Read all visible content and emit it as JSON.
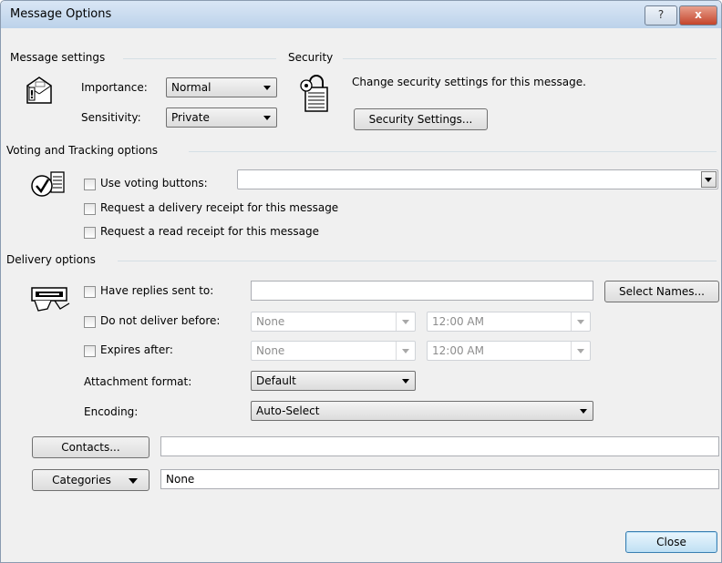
{
  "window": {
    "title": "Message Options",
    "help_glyph": "?",
    "close_glyph": "x"
  },
  "message_settings": {
    "heading": "Message settings",
    "importance_label": "Importance:",
    "importance_value": "Normal",
    "sensitivity_label": "Sensitivity:",
    "sensitivity_value": "Private"
  },
  "security": {
    "heading": "Security",
    "description": "Change security settings for this message.",
    "button_label": "Security Settings..."
  },
  "voting": {
    "heading": "Voting and Tracking options",
    "use_voting_label": "Use voting buttons:",
    "voting_value": "",
    "delivery_receipt_label": "Request a delivery receipt for this message",
    "read_receipt_label": "Request a read receipt for this message"
  },
  "delivery": {
    "heading": "Delivery options",
    "replies_label": "Have replies sent to:",
    "replies_value": "",
    "select_names_label": "Select Names...",
    "do_not_deliver_label": "Do not deliver before:",
    "do_not_deliver_date": "None",
    "do_not_deliver_time": "12:00 AM",
    "expires_label": "Expires after:",
    "expires_date": "None",
    "expires_time": "12:00 AM",
    "attachment_label": "Attachment format:",
    "attachment_value": "Default",
    "encoding_label": "Encoding:",
    "encoding_value": "Auto-Select"
  },
  "contacts": {
    "button_label": "Contacts...",
    "value": ""
  },
  "categories": {
    "button_label": "Categories",
    "value": "None"
  },
  "footer": {
    "close_label": "Close"
  }
}
